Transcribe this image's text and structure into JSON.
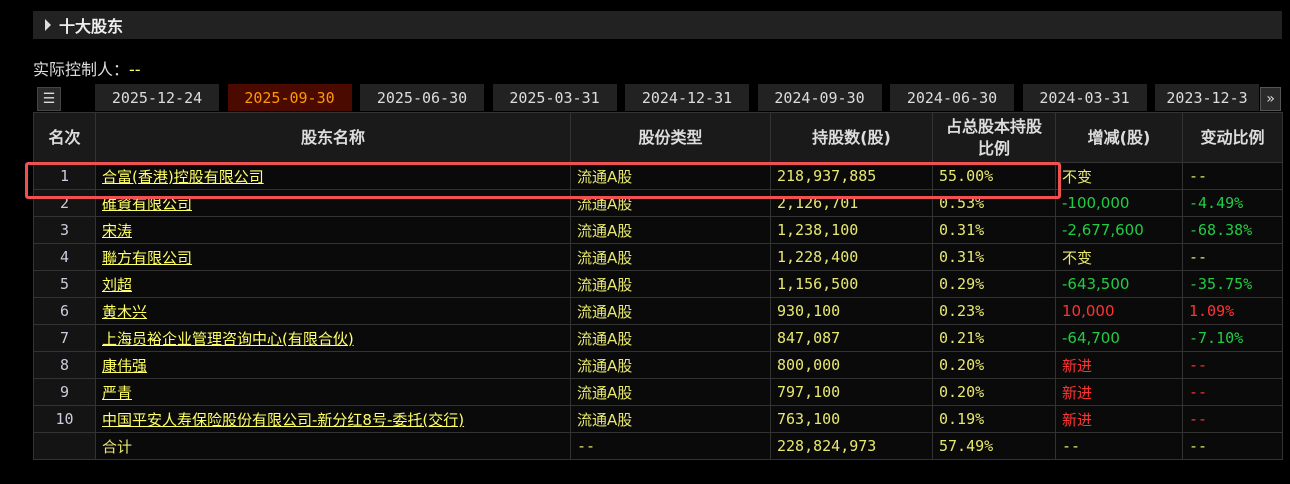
{
  "section_title": "十大股东",
  "controller": {
    "label": "实际控制人：",
    "value": "--"
  },
  "tabs": [
    "2025-12-24",
    "2025-09-30",
    "2025-06-30",
    "2025-03-31",
    "2024-12-31",
    "2024-09-30",
    "2024-06-30",
    "2024-03-31",
    "2023-12-3"
  ],
  "active_tab": "2025-09-30",
  "columns": [
    "名次",
    "股东名称",
    "股份类型",
    "持股数(股)",
    "占总股本持股比例",
    "增减(股)",
    "变动比例"
  ],
  "rows": [
    {
      "rank": "1",
      "name": "合富(香港)控股有限公司",
      "type": "流通A股",
      "shares": "218,937,885",
      "pct": "55.00%",
      "change": "不变",
      "change_pct": "--",
      "dir": "y"
    },
    {
      "rank": "2",
      "name": "碓資有限公司",
      "type": "流通A股",
      "shares": "2,126,701",
      "pct": "0.53%",
      "change": "-100,000",
      "change_pct": "-4.49%",
      "dir": "g"
    },
    {
      "rank": "3",
      "name": "宋涛",
      "type": "流通A股",
      "shares": "1,238,100",
      "pct": "0.31%",
      "change": "-2,677,600",
      "change_pct": "-68.38%",
      "dir": "g"
    },
    {
      "rank": "4",
      "name": "聯方有限公司",
      "type": "流通A股",
      "shares": "1,228,400",
      "pct": "0.31%",
      "change": "不变",
      "change_pct": "--",
      "dir": "y"
    },
    {
      "rank": "5",
      "name": "刘超",
      "type": "流通A股",
      "shares": "1,156,500",
      "pct": "0.29%",
      "change": "-643,500",
      "change_pct": "-35.75%",
      "dir": "g"
    },
    {
      "rank": "6",
      "name": "黄木兴",
      "type": "流通A股",
      "shares": "930,100",
      "pct": "0.23%",
      "change": "10,000",
      "change_pct": "1.09%",
      "dir": "r"
    },
    {
      "rank": "7",
      "name": "上海员裕企业管理咨询中心(有限合伙)",
      "type": "流通A股",
      "shares": "847,087",
      "pct": "0.21%",
      "change": "-64,700",
      "change_pct": "-7.10%",
      "dir": "g"
    },
    {
      "rank": "8",
      "name": "康伟强",
      "type": "流通A股",
      "shares": "800,000",
      "pct": "0.20%",
      "change": "新进",
      "change_pct": "--",
      "dir": "r"
    },
    {
      "rank": "9",
      "name": "严青",
      "type": "流通A股",
      "shares": "797,100",
      "pct": "0.20%",
      "change": "新进",
      "change_pct": "--",
      "dir": "r"
    },
    {
      "rank": "10",
      "name": "中国平安人寿保险股份有限公司-新分红8号-委托(交行)",
      "type": "流通A股",
      "shares": "763,100",
      "pct": "0.19%",
      "change": "新进",
      "change_pct": "--",
      "dir": "r"
    }
  ],
  "total": {
    "label": "合计",
    "type": "--",
    "shares": "228,824,973",
    "pct": "57.49%",
    "change": "--",
    "change_pct": "--"
  },
  "colors": {
    "highlight": "#f05050",
    "up": "#ff3333",
    "down": "#22cc44",
    "neutral": "#e8e870",
    "active_tab_bg": "#4a0a00",
    "active_tab_text": "#ff9900"
  }
}
